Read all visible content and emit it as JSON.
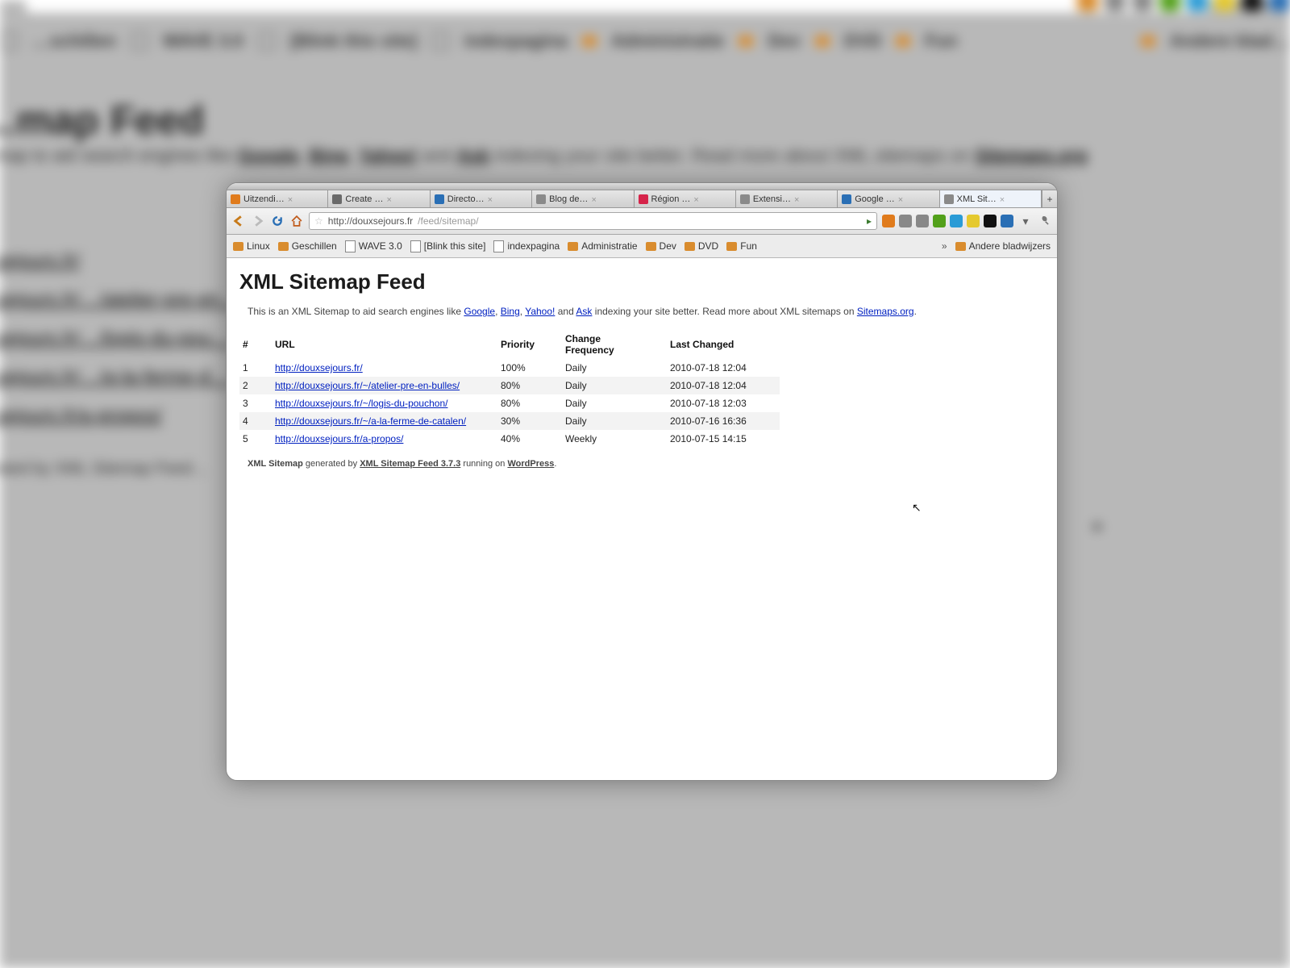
{
  "bg": {
    "heading": "…map Feed",
    "para_pre": "…map to aid search engines like ",
    "para_links": [
      "Google",
      "Bing",
      "Yahoo!"
    ],
    "para_and": " and ",
    "para_ask": "Ask",
    "para_post": " indexing your site better. Read more about XML sitemaps on ",
    "para_end": "Sitemaps.org",
    "list": [
      "…sejours.fr/",
      "…sejours.fr/…/atelier-pre-en…",
      "…sejours.fr/…/logis-du-pou…",
      "…sejours.fr/…/a-la-ferme-d…",
      "…sejours.fr/a-propos/"
    ],
    "generated": "…rated by  XML Sitemap Feed…",
    "bookmarks": [
      "…schillen",
      "WAVE 3.0",
      "[Blink this site]",
      "indexpagina",
      "Administratie",
      "Dev",
      "DVD",
      "Fun",
      "Andere blad…"
    ]
  },
  "browser": {
    "tabs": [
      {
        "label": "Uitzendi…",
        "color": "#e07b1c"
      },
      {
        "label": "Create …",
        "color": "#6a6a6a"
      },
      {
        "label": "Directo…",
        "color": "#2a6fb5"
      },
      {
        "label": "Blog de…",
        "color": "#8a8a8a"
      },
      {
        "label": "Région …",
        "color": "#d6244a"
      },
      {
        "label": "Extensi…",
        "color": "#8a8a8a"
      },
      {
        "label": "Google …",
        "color": "#2a6fb5"
      },
      {
        "label": "XML Sit…",
        "color": "#8a8a8a",
        "active": true
      }
    ],
    "url_prefix": "http://douxsejours.fr",
    "url_suffix": "/feed/sitemap/",
    "ext_colors": [
      "#e07b1c",
      "#888",
      "#888",
      "#52a01a",
      "#2a9bd6",
      "#e5c92e",
      "#111",
      "#2a6fb5"
    ],
    "bookmarks": [
      {
        "icon": "folder",
        "label": "Linux"
      },
      {
        "icon": "folder",
        "label": "Geschillen"
      },
      {
        "icon": "page",
        "label": "WAVE 3.0"
      },
      {
        "icon": "page",
        "label": "[Blink this site]"
      },
      {
        "icon": "page",
        "label": "indexpagina"
      },
      {
        "icon": "folder",
        "label": "Administratie"
      },
      {
        "icon": "folder",
        "label": "Dev"
      },
      {
        "icon": "folder",
        "label": "DVD"
      },
      {
        "icon": "folder",
        "label": "Fun"
      }
    ],
    "bookmarks_overflow": "»",
    "bookmarks_right": {
      "icon": "folder",
      "label": "Andere bladwijzers"
    }
  },
  "page": {
    "title": "XML Sitemap Feed",
    "desc_pre": "This is an XML Sitemap to aid search engines like ",
    "desc_links": [
      "Google",
      "Bing",
      "Yahoo!"
    ],
    "desc_and": " and ",
    "desc_ask": "Ask",
    "desc_mid": " indexing your site better. Read more about XML sitemaps on ",
    "desc_end": "Sitemaps.org",
    "columns": [
      "#",
      "URL",
      "Priority",
      "Change Frequency",
      "Last Changed"
    ],
    "rows": [
      {
        "n": "1",
        "url": "http://douxsejours.fr/",
        "priority": "100%",
        "freq": "Daily",
        "changed": "2010-07-18 12:04"
      },
      {
        "n": "2",
        "url": "http://douxsejours.fr/~/atelier-pre-en-bulles/",
        "priority": "80%",
        "freq": "Daily",
        "changed": "2010-07-18 12:04"
      },
      {
        "n": "3",
        "url": "http://douxsejours.fr/~/logis-du-pouchon/",
        "priority": "80%",
        "freq": "Daily",
        "changed": "2010-07-18 12:03"
      },
      {
        "n": "4",
        "url": "http://douxsejours.fr/~/a-la-ferme-de-catalen/",
        "priority": "30%",
        "freq": "Daily",
        "changed": "2010-07-16 16:36"
      },
      {
        "n": "5",
        "url": "http://douxsejours.fr/a-propos/",
        "priority": "40%",
        "freq": "Weekly",
        "changed": "2010-07-15 14:15"
      }
    ],
    "footer_strong": "XML Sitemap",
    "footer_mid": " generated by ",
    "footer_link1": "XML Sitemap Feed 3.7.3",
    "footer_mid2": " running on ",
    "footer_link2": "WordPress",
    "footer_dot": "."
  }
}
